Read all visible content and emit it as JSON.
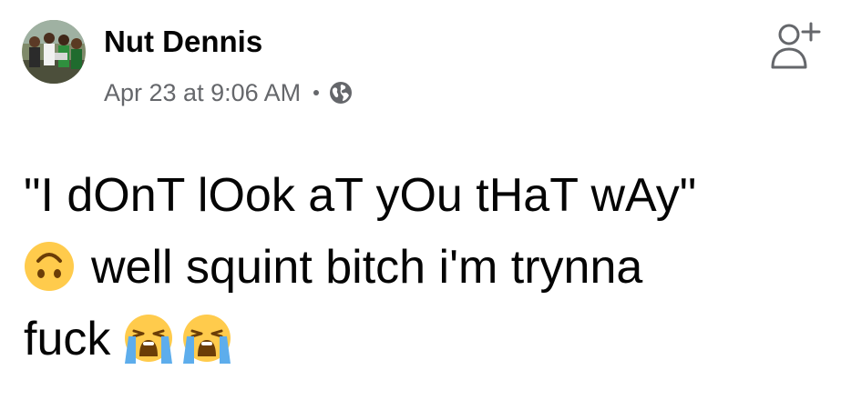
{
  "post": {
    "author_name": "Nut Dennis",
    "timestamp": "Apr 23 at 9:06 AM",
    "separator": "•",
    "audience_icon": "globe-icon",
    "add_friend_icon": "add-friend-icon",
    "text": {
      "line1": "\"I dOnT lOok aT yOu tHaT wAy\"",
      "line2_emoji": "upside-down-face-emoji",
      "line2": "well squint bitch i'm trynna",
      "line3": "fuck",
      "line3_emojis": [
        "loudly-crying-face-emoji",
        "loudly-crying-face-emoji"
      ]
    }
  },
  "colors": {
    "text": "#050505",
    "secondary_text": "#65676b",
    "emoji_yellow": "#ffcb4c",
    "tears": "#5dadec"
  }
}
